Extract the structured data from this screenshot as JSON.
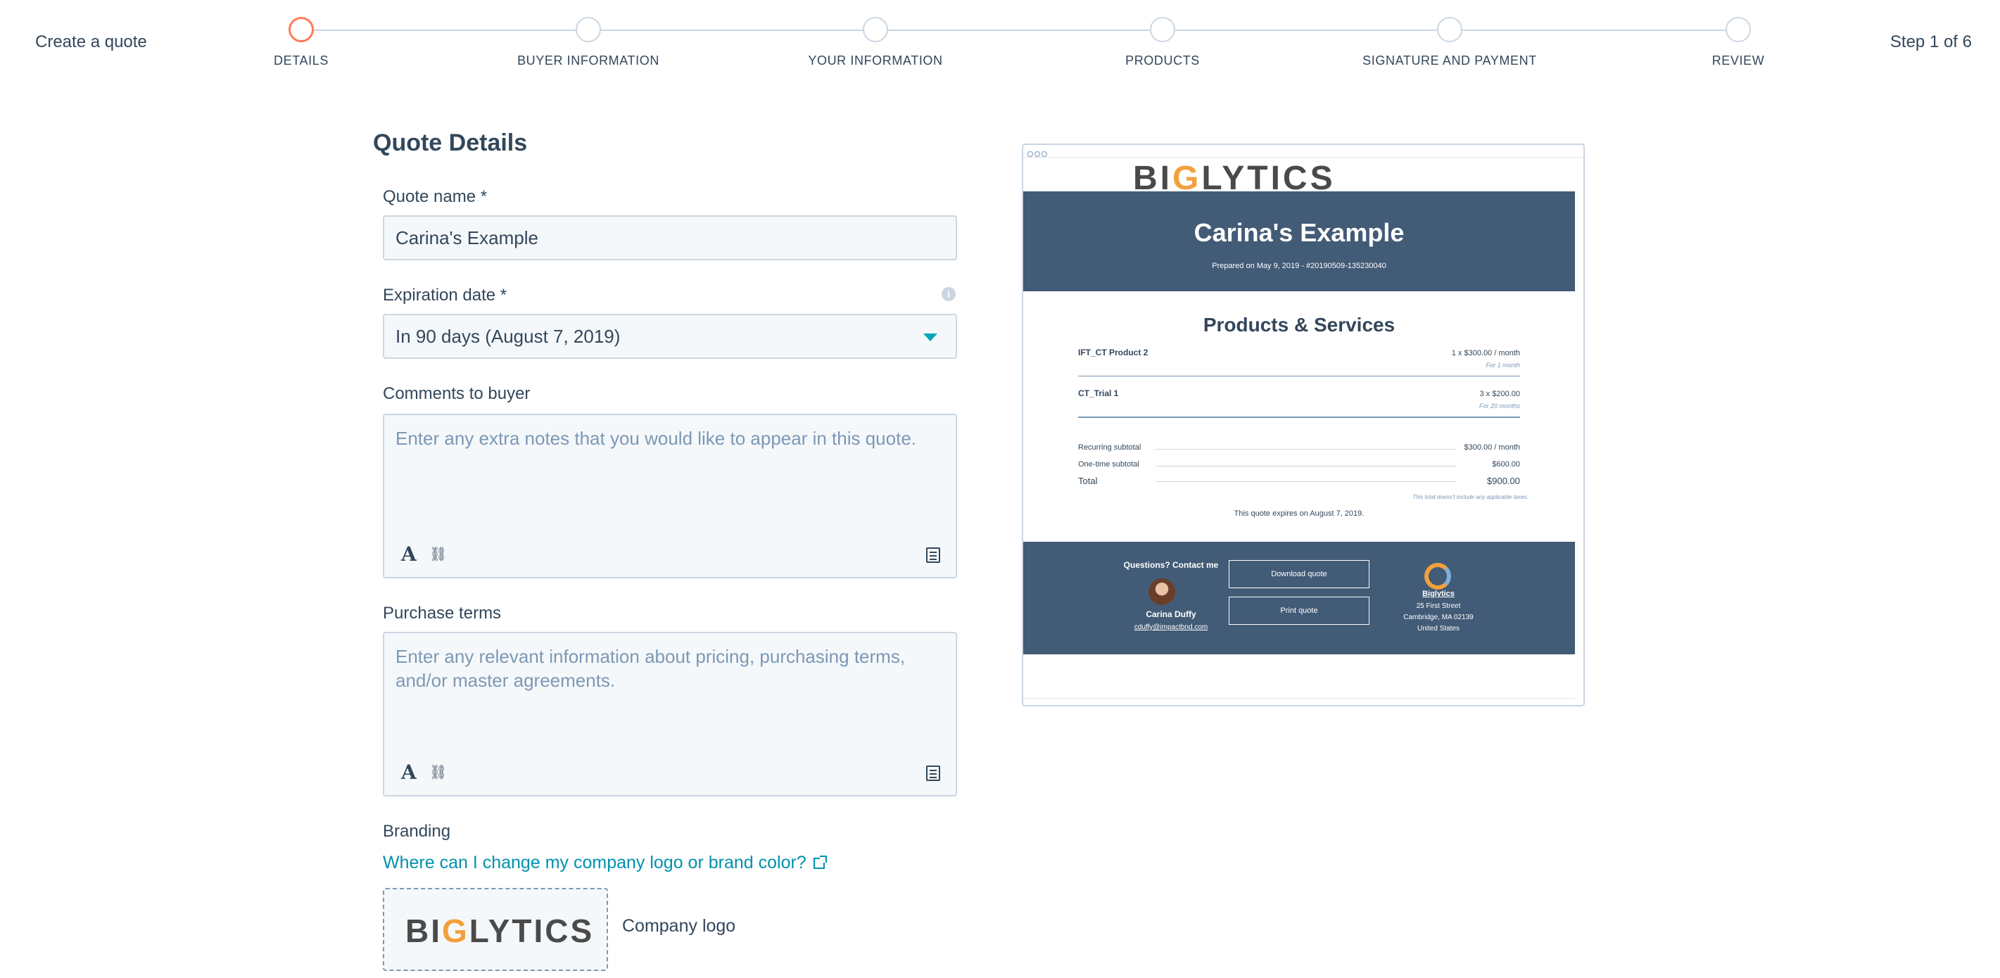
{
  "header": {
    "create_label": "Create a quote",
    "step_count": "Step 1 of 6",
    "steps": [
      {
        "label": "DETAILS",
        "active": true
      },
      {
        "label": "BUYER INFORMATION",
        "active": false
      },
      {
        "label": "YOUR INFORMATION",
        "active": false
      },
      {
        "label": "PRODUCTS",
        "active": false
      },
      {
        "label": "SIGNATURE AND PAYMENT",
        "active": false
      },
      {
        "label": "REVIEW",
        "active": false
      }
    ]
  },
  "form": {
    "title": "Quote Details",
    "quote_name": {
      "label": "Quote name *",
      "value": "Carina's Example"
    },
    "expiration": {
      "label": "Expiration date *",
      "value": "In 90 days (August 7, 2019)"
    },
    "comments": {
      "label": "Comments to buyer",
      "placeholder": "Enter any extra notes that you would like to appear in this quote."
    },
    "purchase_terms": {
      "label": "Purchase terms",
      "placeholder": "Enter any relevant information about pricing, purchasing terms, and/or master agreements."
    },
    "branding": {
      "label": "Branding",
      "help_link": "Where can I change my company logo or brand color?",
      "logo_caption": "Company logo",
      "logo_text_pre": "BI",
      "logo_text_g": "G",
      "logo_text_post": "LYTICS"
    }
  },
  "preview": {
    "logo_pre": "BI",
    "logo_g": "G",
    "logo_post": "LYTICS",
    "title": "Carina's Example",
    "prepared": "Prepared on May 9, 2019 - #20190509-135230040",
    "section_title": "Products & Services",
    "items": [
      {
        "name": "IFT_CT Product 2",
        "price": "1 x $300.00 / month",
        "duration": "For 1 month"
      },
      {
        "name": "CT_Trial 1",
        "price": "3 x $200.00",
        "duration": "For 20 months"
      }
    ],
    "summary": [
      {
        "label": "Recurring subtotal",
        "value": "$300.00 / month"
      },
      {
        "label": "One-time subtotal",
        "value": "$600.00"
      },
      {
        "label": "Total",
        "value": "$900.00"
      }
    ],
    "tax_note": "This total doesn't include any applicable taxes.",
    "expires": "This quote expires on August 7, 2019.",
    "footer": {
      "questions": "Questions? Contact me",
      "contact_name": "Carina Duffy",
      "contact_email": "cduffy@impactbnd.com",
      "download_btn": "Download quote",
      "print_btn": "Print quote",
      "company": "Biglytics",
      "address1": "25 First Street",
      "address2": "Cambridge, MA 02139",
      "address3": "United States"
    }
  },
  "colors": {
    "accent": "#ff7a59",
    "link": "#0091ae",
    "caret": "#00a4bd",
    "header_band": "#425b76",
    "text": "#33475b"
  }
}
